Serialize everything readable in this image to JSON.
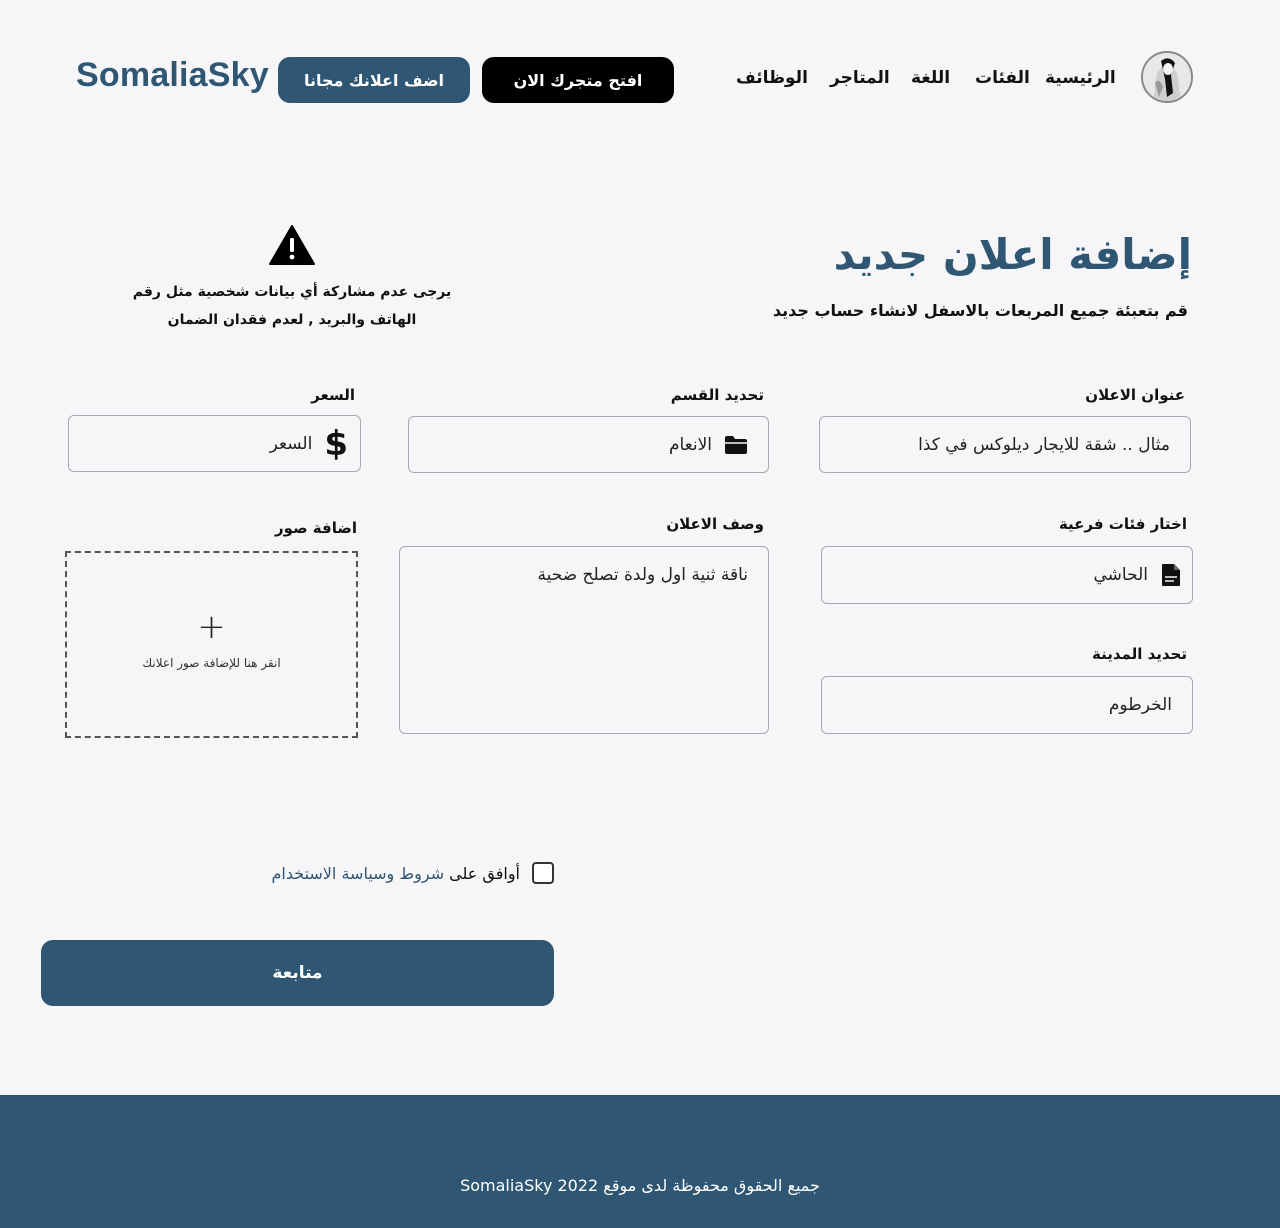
{
  "header": {
    "logo": "SomaliaSky",
    "post_ad_button": "اضف اعلانك مجانا",
    "open_store_button": "افتح متجرك الان",
    "nav": {
      "home": "الرئيسية",
      "categories": "الفئات",
      "language": "اللغة",
      "stores": "المتاجر",
      "jobs": "الوظائف"
    }
  },
  "page": {
    "title": "إضافة اعلان جديد",
    "subtitle": "قم بتعبئة جميع المربعات بالاسفل لانشاء حساب جديد",
    "warning_line1": "يرجى عدم مشاركة أي بيانات شخصية مثل رقم",
    "warning_line2": "الهاتف والبريد , لعدم فقدان الضمان"
  },
  "form": {
    "ad_title_label": "عنوان الاعلان",
    "ad_title_placeholder": "مثال .. شقة للايجار ديلوكس في كذا",
    "section_label": "تحديد القسم",
    "section_value": "الانعام",
    "price_label": "السعر",
    "price_placeholder": "السعر",
    "subcategory_label": "اختار فئات فرعية",
    "subcategory_value": "الحاشي",
    "description_label": "وصف الاعلان",
    "description_value": "ناقة ثنية اول ولدة تصلح ضحية",
    "photos_label": "اضافة صور",
    "photos_hint": "انقر هنا للإضافة صور اعلانك",
    "city_label": "تحديد المدينة",
    "city_value": "الخرطوم",
    "agree_prefix": "أوافق على",
    "agree_link": "شروط وسياسة الاستخدام",
    "continue_button": "متابعة"
  },
  "footer": {
    "copyright": "جميع الحقوق محفوظة لدى موقع SomaliaSky 2022"
  },
  "colors": {
    "primary": "#2f5672",
    "background": "#f6f6f8",
    "black_button": "#000000"
  }
}
